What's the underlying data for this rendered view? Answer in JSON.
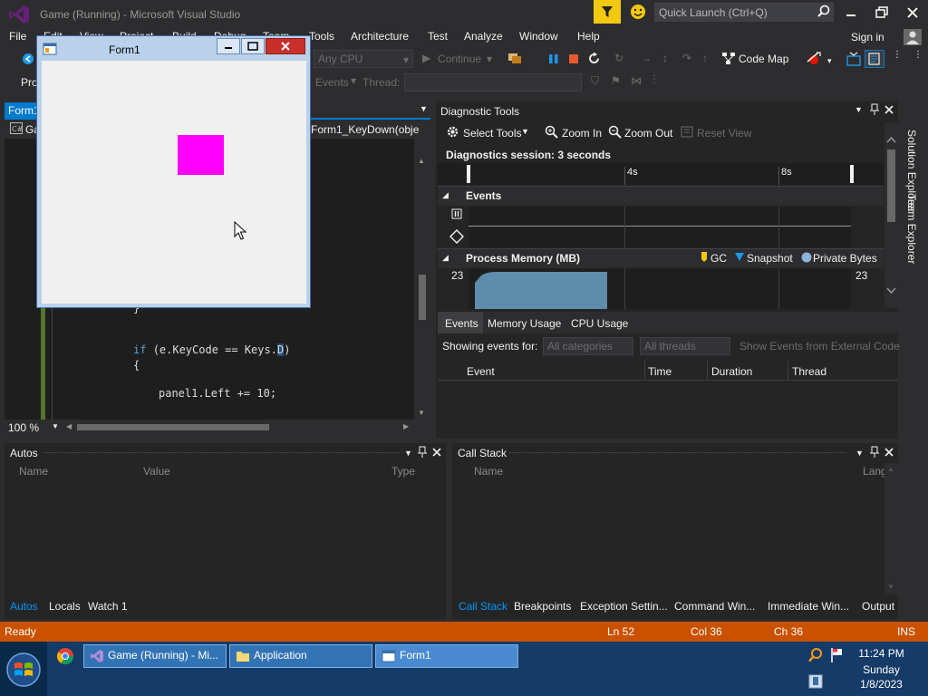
{
  "titlebar": {
    "title": "Game (Running) - Microsoft Visual Studio",
    "quick_launch_placeholder": "Quick Launch (Ctrl+Q)"
  },
  "menu": {
    "items": [
      "File",
      "Edit",
      "View",
      "Project",
      "Build",
      "Debug",
      "Team",
      "Tools",
      "Architecture",
      "Test",
      "Analyze",
      "Window",
      "Help"
    ],
    "sign_in": "Sign in"
  },
  "toolbar": {
    "platform": "Any CPU",
    "continue_label": "Continue",
    "code_map": "Code Map",
    "process_label": "Pro",
    "events_label": "Events",
    "thread_label": "Thread:"
  },
  "editor": {
    "doc_tab": "Form1",
    "nav_left": "Ga",
    "nav_right": "Form1_KeyDown(obje",
    "brace": "}",
    "line1_kw": "if",
    "line1_rest_a": "(e.KeyCode == Keys.",
    "line1_sel": "D",
    "line1_rest_b": ")",
    "line2": "{",
    "line3": "panel1.Left += 10;",
    "zoom": "100 %"
  },
  "diagnostic": {
    "title": "Diagnostic Tools",
    "select_tools": "Select Tools",
    "zoom_in": "Zoom In",
    "zoom_out": "Zoom Out",
    "reset_view": "Reset View",
    "session": "Diagnostics session: 3 seconds",
    "tick_4s": "4s",
    "tick_8s": "8s",
    "events_header": "Events",
    "memory_header": "Process Memory (MB)",
    "legend_gc": "GC",
    "legend_snapshot": "Snapshot",
    "legend_private": "Private Bytes",
    "mem_left": "23",
    "mem_right": "23",
    "tabs": [
      "Events",
      "Memory Usage",
      "CPU Usage"
    ],
    "showing_events": "Showing events for:",
    "all_categories": "All categories",
    "all_threads": "All threads",
    "show_external": "Show Events from External Code",
    "columns": [
      "Event",
      "Time",
      "Duration",
      "Thread"
    ]
  },
  "side_rail": {
    "solution_explorer": "Solution Explorer",
    "team_explorer": "Team Explorer"
  },
  "autos": {
    "title": "Autos",
    "columns": [
      "Name",
      "Value",
      "Type"
    ],
    "tabs": [
      "Autos",
      "Locals",
      "Watch 1"
    ]
  },
  "callstack": {
    "title": "Call Stack",
    "columns": [
      "Name",
      "Lang"
    ],
    "tabs": [
      "Call Stack",
      "Breakpoints",
      "Exception Settin...",
      "Command Win...",
      "Immediate Win...",
      "Output"
    ]
  },
  "statusbar": {
    "ready": "Ready",
    "ln": "Ln 52",
    "col": "Col 36",
    "ch": "Ch 36",
    "ins": "INS"
  },
  "taskbar": {
    "buttons": [
      "Game (Running) - Mi...",
      "Application",
      "Form1"
    ],
    "time": "11:24 PM",
    "day": "Sunday",
    "date": "1/8/2023"
  },
  "form1": {
    "title": "Form1"
  },
  "colors": {
    "accent": "#007acc",
    "status": "#ca5100",
    "panel": "#ff00ff"
  }
}
